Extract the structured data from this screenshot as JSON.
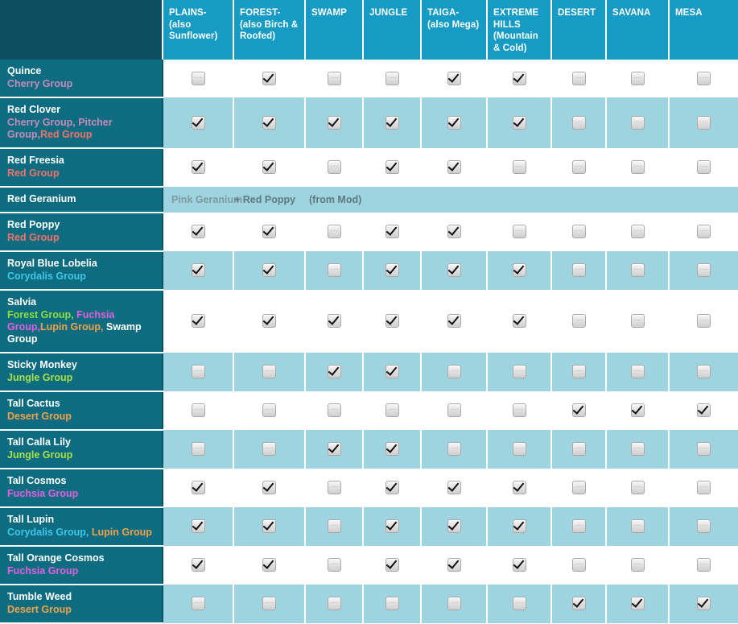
{
  "header": {
    "corner_label": "",
    "columns": [
      "PLAINS- (also Sunflower)",
      "FOREST- (also Birch & Roofed)",
      "SWAMP",
      "JUNGLE",
      "TAIGA- (also Mega)",
      "EXTREME HILLS (Mountain & Cold)",
      "DESERT",
      "SAVANA",
      "MESA"
    ]
  },
  "colors": {
    "header_blue": "#159bc4",
    "corner_dark": "#0d4f60",
    "rowlabel_teal": "#0d6c80",
    "stripe_blue": "#9ed3e0",
    "plain_white": "#ffffff",
    "group_cherry": "#c58bbd",
    "group_pitcher": "#c58bbd",
    "group_red": "#f0736a",
    "group_corydalis": "#3fc7e8",
    "group_forest": "#8ede3c",
    "group_fuchsia": "#e45ee0",
    "group_lupin": "#f0a24a",
    "group_swamp": "#ffffff",
    "group_jungle": "#a8e04a",
    "group_desert": "#f0a24a"
  },
  "rows": [
    {
      "name": "Quince",
      "groups": [
        {
          "text": "Cherry Group",
          "color": "#c58bbd"
        }
      ],
      "checks": [
        false,
        true,
        false,
        false,
        true,
        true,
        false,
        false,
        false
      ],
      "stripe": false
    },
    {
      "name": "Red Clover",
      "groups": [
        {
          "text": "Cherry Group,",
          "color": "#c58bbd"
        },
        {
          "text": " Pitcher Group,",
          "color": "#c58bbd"
        },
        {
          "text": "Red Group",
          "color": "#f0736a"
        }
      ],
      "checks": [
        true,
        true,
        true,
        true,
        true,
        true,
        false,
        false,
        false
      ],
      "stripe": true
    },
    {
      "name": "Red Freesia",
      "groups": [
        {
          "text": "Red Group",
          "color": "#f0736a"
        }
      ],
      "checks": [
        true,
        true,
        false,
        true,
        true,
        false,
        false,
        false,
        false
      ],
      "stripe": false
    },
    {
      "name": "Red Geranium",
      "groups": [],
      "note": {
        "a": "Pink Geranium",
        "b": "+ Red Poppy",
        "c": "(from Mod)"
      },
      "stripe": true
    },
    {
      "name": "Red Poppy",
      "groups": [
        {
          "text": "Red Group",
          "color": "#f0736a"
        }
      ],
      "checks": [
        true,
        true,
        false,
        true,
        true,
        false,
        false,
        false,
        false
      ],
      "stripe": false
    },
    {
      "name": "Royal Blue Lobelia",
      "groups": [
        {
          "text": "Corydalis Group",
          "color": "#3fc7e8"
        }
      ],
      "checks": [
        true,
        true,
        false,
        true,
        true,
        true,
        false,
        false,
        false
      ],
      "stripe": true
    },
    {
      "name": "Salvia",
      "groups": [
        {
          "text": "Forest Group,",
          "color": "#8ede3c"
        },
        {
          "text": " Fuchsia Group,",
          "color": "#e45ee0"
        },
        {
          "text": "Lupin Group,",
          "color": "#f0a24a"
        },
        {
          "text": " Swamp Group",
          "color": "#ffffff"
        }
      ],
      "checks": [
        true,
        true,
        true,
        true,
        true,
        true,
        false,
        false,
        false
      ],
      "stripe": false
    },
    {
      "name": "Sticky Monkey",
      "groups": [
        {
          "text": "Jungle Group",
          "color": "#a8e04a"
        }
      ],
      "checks": [
        false,
        false,
        true,
        true,
        false,
        false,
        false,
        false,
        false
      ],
      "stripe": true
    },
    {
      "name": "Tall Cactus",
      "groups": [
        {
          "text": "Desert Group",
          "color": "#f0a24a"
        }
      ],
      "checks": [
        false,
        false,
        false,
        false,
        false,
        false,
        true,
        true,
        true
      ],
      "stripe": false
    },
    {
      "name": "Tall Calla Lily",
      "groups": [
        {
          "text": "Jungle Group",
          "color": "#a8e04a"
        }
      ],
      "checks": [
        false,
        false,
        true,
        true,
        false,
        false,
        false,
        false,
        false
      ],
      "stripe": true
    },
    {
      "name": "Tall Cosmos",
      "groups": [
        {
          "text": "Fuchsia Group",
          "color": "#e45ee0"
        }
      ],
      "checks": [
        true,
        true,
        false,
        true,
        true,
        true,
        false,
        false,
        false
      ],
      "stripe": false
    },
    {
      "name": "Tall Lupin",
      "groups": [
        {
          "text": "Corydalis Group,",
          "color": "#3fc7e8"
        },
        {
          "text": " Lupin Group",
          "color": "#f0a24a"
        }
      ],
      "checks": [
        true,
        true,
        false,
        true,
        true,
        true,
        false,
        false,
        false
      ],
      "stripe": true
    },
    {
      "name": "Tall Orange Cosmos",
      "groups": [
        {
          "text": "Fuchsia Group",
          "color": "#e45ee0"
        }
      ],
      "checks": [
        true,
        true,
        false,
        true,
        true,
        true,
        false,
        false,
        false
      ],
      "stripe": false
    },
    {
      "name": "Tumble Weed",
      "groups": [
        {
          "text": "Desert Group",
          "color": "#f0a24a"
        }
      ],
      "checks": [
        false,
        false,
        false,
        false,
        false,
        false,
        true,
        true,
        true
      ],
      "stripe": true
    }
  ]
}
